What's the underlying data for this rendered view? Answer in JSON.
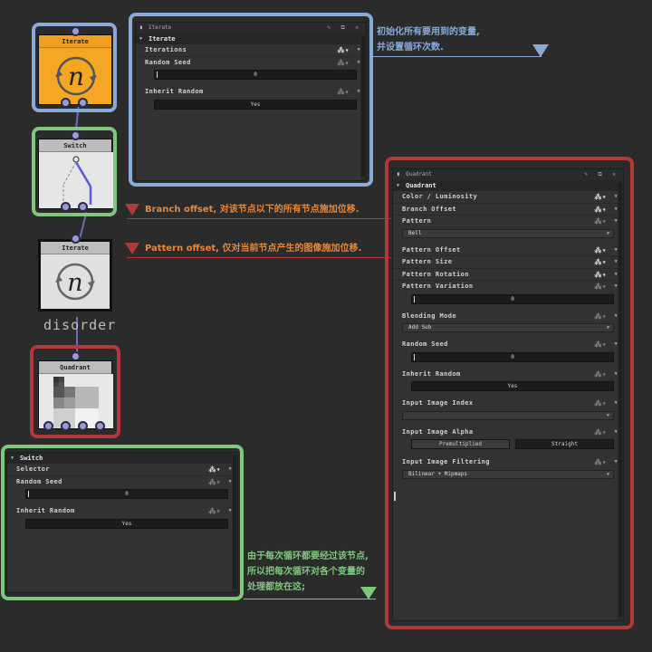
{
  "colors": {
    "blue_accent": "#8aaad8",
    "green_accent": "#7ec87e",
    "red_accent": "#b03a3a",
    "orange_annot": "#e6873a",
    "node_orange": "#f5a623"
  },
  "nodes": {
    "iterate_1": {
      "title": "Iterate",
      "icon": "n"
    },
    "switch": {
      "title": "Switch"
    },
    "iterate_2": {
      "title": "Iterate",
      "icon": "n",
      "caption": "disorder"
    },
    "quadrant": {
      "title": "Quadrant"
    }
  },
  "iterate_panel": {
    "window_title": "Iterate",
    "group": "Iterate",
    "params": {
      "iterations": "Iterations",
      "random_seed": "Random Seed",
      "random_seed_value": "0",
      "inherit_random": "Inherit Random",
      "inherit_random_value": "Yes"
    }
  },
  "quadrant_panel": {
    "window_title": "Quadrant",
    "group": "Quadrant",
    "params": {
      "color_luminosity": "Color / Luminosity",
      "branch_offset": "Branch Offset",
      "pattern": "Pattern",
      "pattern_value": "Bell",
      "pattern_offset": "Pattern  Offset",
      "pattern_size": "Pattern Size",
      "pattern_rotation": "Pattern Rotation",
      "pattern_variation": "Pattern Variation",
      "pattern_variation_value": "0",
      "blending_mode": "Blending Mode",
      "blending_mode_value": "Add Sub",
      "random_seed": "Random Seed",
      "random_seed_value": "0",
      "inherit_random": "Inherit Random",
      "inherit_random_value": "Yes",
      "input_image_index": "Input Image Index",
      "input_image_alpha": "Input Image Alpha",
      "alpha_opt1": "Premultiplied",
      "alpha_opt2": "Straight",
      "input_image_filtering": "Input Image Filtering",
      "input_image_filtering_value": "Bilinear + Mipmaps"
    }
  },
  "switch_panel": {
    "group": "Switch",
    "params": {
      "selector": "Selector",
      "random_seed": "Random Seed",
      "random_seed_value": "0",
      "inherit_random": "Inherit Random",
      "inherit_random_value": "Yes"
    }
  },
  "annotations": {
    "top_line1": "初始化所有要用到的变量,",
    "top_line2": "并设置循环次数.",
    "branch_offset_note": "Branch offset, 对该节点以下的所有节点施加位移.",
    "pattern_offset_note": "Pattern offset, 仅对当前节点产生的图像施加位移.",
    "bottom_line1": "由于每次循环都要经过该节点,",
    "bottom_line2": "所以把每次循环对各个变量的",
    "bottom_line3": "处理都放在这;"
  }
}
